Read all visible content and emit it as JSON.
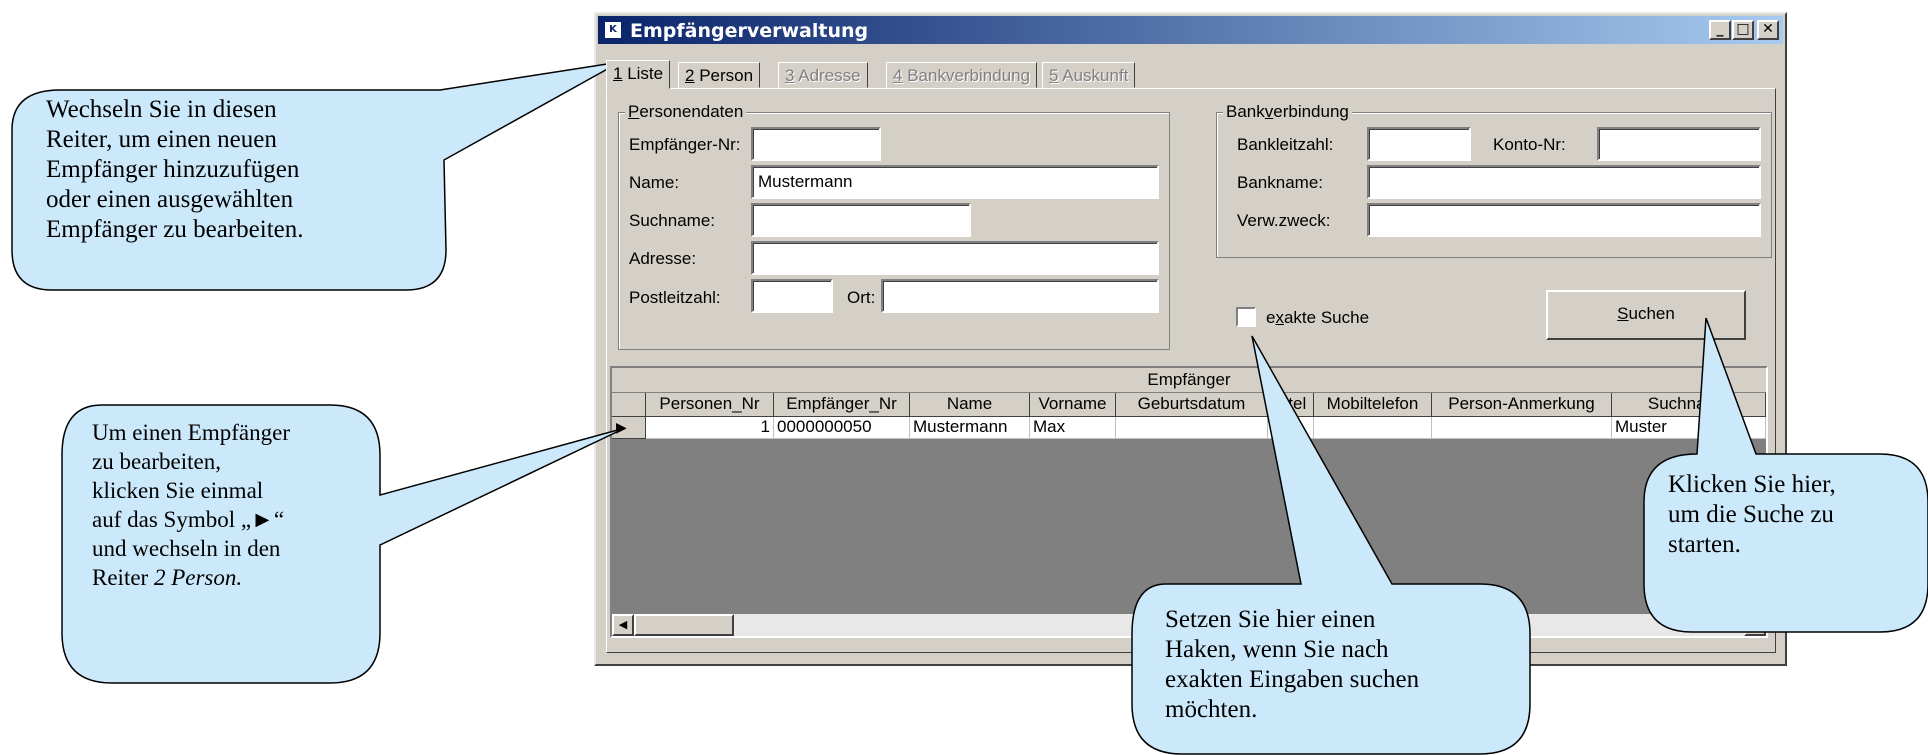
{
  "window": {
    "title": "Empfängerverwaltung",
    "app_icon": "K",
    "buttons": {
      "minimize": "_",
      "maximize": "□",
      "close": "✕"
    }
  },
  "tabs": [
    {
      "num": "1",
      "label": " Liste",
      "state": "active"
    },
    {
      "num": "2",
      "label": " Person",
      "state": "enabled"
    },
    {
      "num": "3",
      "label": " Adresse",
      "state": "disabled"
    },
    {
      "num": "4",
      "label": " Bankverbindung",
      "state": "disabled"
    },
    {
      "num": "5",
      "label": " Auskunft",
      "state": "disabled"
    }
  ],
  "person_group": {
    "title_u": "P",
    "title_rest": "ersonendaten",
    "fields": {
      "empfaenger_nr": {
        "label": "Empfänger-Nr:",
        "value": ""
      },
      "name": {
        "label": "Name:",
        "value": "Mustermann"
      },
      "suchname": {
        "label": "Suchname:",
        "value": ""
      },
      "adresse": {
        "label": "Adresse:",
        "value": ""
      },
      "postleitzahl": {
        "label": "Postleitzahl:",
        "value": ""
      },
      "ort": {
        "label": "Ort:",
        "value": ""
      }
    }
  },
  "bank_group": {
    "title_a": "Bank",
    "title_u": "v",
    "title_b": "erbindung",
    "fields": {
      "bankleitzahl": {
        "label": "Bankleitzahl:",
        "value": ""
      },
      "konto_nr": {
        "label": "Konto-Nr:",
        "value": ""
      },
      "bankname": {
        "label": "Bankname:",
        "value": ""
      },
      "verw_zweck": {
        "label": "Verw.zweck:",
        "value": ""
      }
    }
  },
  "exact_search": {
    "a": "e",
    "u": "x",
    "b": "akte Suche",
    "checked": false
  },
  "search_button": {
    "u": "S",
    "rest": "uchen"
  },
  "grid": {
    "title": "Empfänger",
    "columns": [
      "Personen_Nr",
      "Empfänger_Nr",
      "Name",
      "Vorname",
      "Geburtsdatum",
      "Titel",
      "Mobiltelefon",
      "Person-Anmerkung",
      "Suchname"
    ],
    "rows": [
      [
        "1",
        "0000000050",
        "Mustermann",
        "Max",
        "",
        "",
        "",
        "",
        "Muster"
      ]
    ],
    "row_indicator": "▶"
  },
  "callouts": {
    "tab": [
      "Wechseln Sie in diesen",
      "Reiter, um einen neuen",
      "Empfänger hinzuzufügen",
      "oder einen ausgewählten",
      "Empfänger zu bearbeiten."
    ],
    "edit": [
      "Um einen Empfänger",
      "zu bearbeiten,",
      "klicken Sie einmal",
      "auf das Symbol „►“",
      "und wechseln in den",
      "Reiter "
    ],
    "edit_italic": "2 Person.",
    "exact": [
      "Setzen Sie hier einen",
      "Haken, wenn Sie nach",
      "exakten Eingaben suchen",
      "möchten."
    ],
    "search": [
      "Klicken Sie hier,",
      "um die Suche zu",
      "starten."
    ]
  },
  "colors": {
    "callout_fill": "#cce9fb",
    "titlebar": "#0a246a",
    "window": "#d4d0c8"
  }
}
